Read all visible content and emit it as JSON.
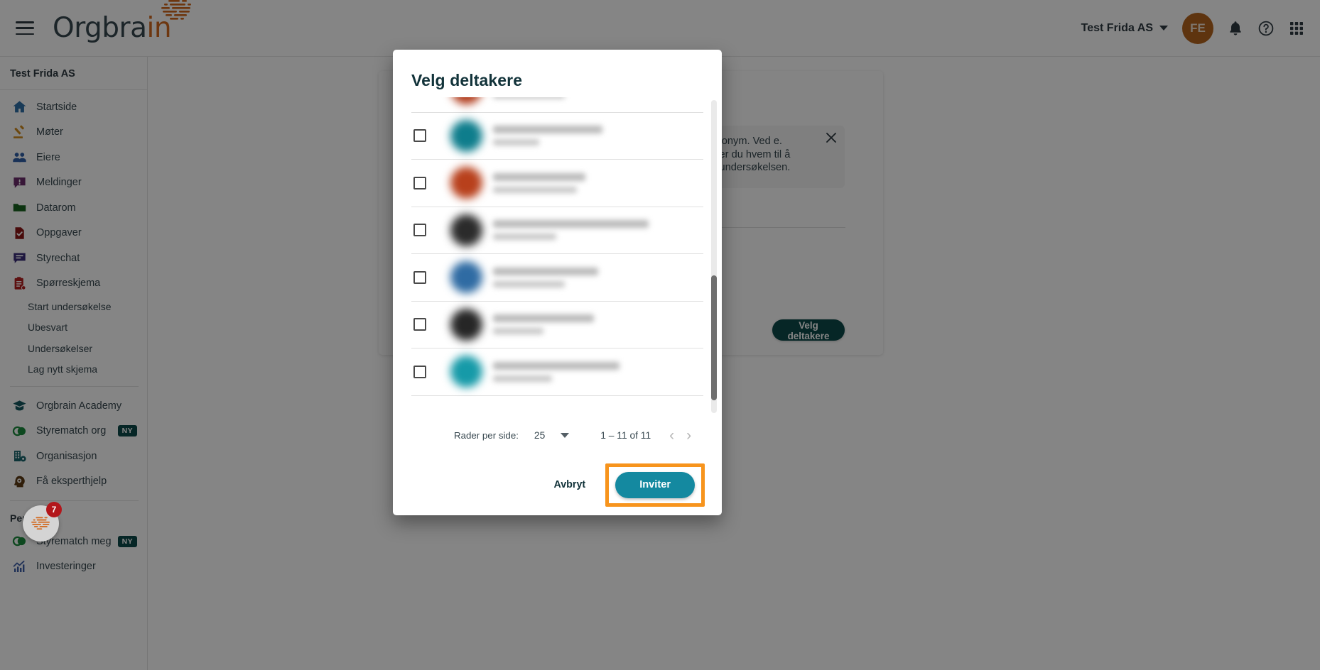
{
  "topbar": {
    "menu_icon": "hamburger-menu-icon",
    "logo_text_main": "Orgbra",
    "logo_text_accent": "in",
    "org_switcher": "Test Frida AS",
    "avatar_initials": "FE",
    "notifications_icon": "bell-icon",
    "help_icon": "question-circle-icon",
    "apps_icon": "apps-grid-icon"
  },
  "sidebar": {
    "org_name": "Test Frida AS",
    "items": [
      {
        "label": "Startside",
        "icon": "home-icon",
        "color": "#2f6fa8"
      },
      {
        "label": "Møter",
        "icon": "gavel-icon",
        "color": "#d08a1e"
      },
      {
        "label": "Eiere",
        "icon": "people-icon",
        "color": "#2f5fa8"
      },
      {
        "label": "Meldinger",
        "icon": "message-alert-icon",
        "color": "#6b2d6b"
      },
      {
        "label": "Datarom",
        "icon": "folder-icon",
        "color": "#17621f"
      },
      {
        "label": "Oppgaver",
        "icon": "task-check-icon",
        "color": "#8c1616"
      },
      {
        "label": "Styrechat",
        "icon": "chat-icon",
        "color": "#3b2d7a"
      },
      {
        "label": "Spørreskjema",
        "icon": "clipboard-icon",
        "color": "#b32020"
      }
    ],
    "sub_items": [
      "Start undersøkelse",
      "Ubesvart",
      "Undersøkelser",
      "Lag nytt skjema"
    ],
    "items2": [
      {
        "label": "Orgbrain Academy",
        "icon": "graduation-cap-icon",
        "color": "#14565e",
        "badge": ""
      },
      {
        "label": "Styrematch org",
        "icon": "venn-circles-icon",
        "color": "#1a8a3c",
        "badge": "NY"
      },
      {
        "label": "Organisasjon",
        "icon": "building-gear-icon",
        "color": "#17646b",
        "badge": ""
      },
      {
        "label": "Få eksperthjelp",
        "icon": "head-gear-icon",
        "color": "#5c3a14",
        "badge": ""
      }
    ],
    "personal_label": "Personlig",
    "items3": [
      {
        "label": "Styrematch meg",
        "icon": "venn-circles-icon",
        "color": "#1a8a3c",
        "badge": "NY"
      },
      {
        "label": "Investeringer",
        "icon": "chart-growth-icon",
        "color": "#3f5fa8",
        "badge": ""
      }
    ]
  },
  "background_page": {
    "info_text": "entlig eller anonym. Ved e. Deretter velger du hvem  til å skrive en e-eundersøkelsen.",
    "info_close_icon": "close-icon",
    "select_participants_button": "Velg deltakere"
  },
  "modal": {
    "title": "Velg deltakere",
    "rows": [
      {
        "avatar_color": "#b03a1a",
        "checked": false
      },
      {
        "avatar_color": "#0e7d8c",
        "checked": false
      },
      {
        "avatar_color": "#b8401c",
        "checked": false
      },
      {
        "avatar_color": "#2b2b2b",
        "checked": false
      },
      {
        "avatar_color": "#2f6ba3",
        "checked": false
      },
      {
        "avatar_color": "#262626",
        "checked": false
      },
      {
        "avatar_color": "#169aa8",
        "checked": false
      }
    ],
    "pagination": {
      "rows_per_page_label": "Rader per side:",
      "rows_per_page_value": "25",
      "dropdown_icon": "chevron-down-icon",
      "range_text": "1 – 11 of 11",
      "prev_icon": "chevron-left-icon",
      "next_icon": "chevron-right-icon"
    },
    "cancel_label": "Avbryt",
    "invite_label": "Inviter",
    "highlight_color": "#f7941d",
    "invite_color": "#1489a0"
  },
  "help_widget": {
    "icon": "orgbrain-brain-icon",
    "badge_count": "7"
  }
}
